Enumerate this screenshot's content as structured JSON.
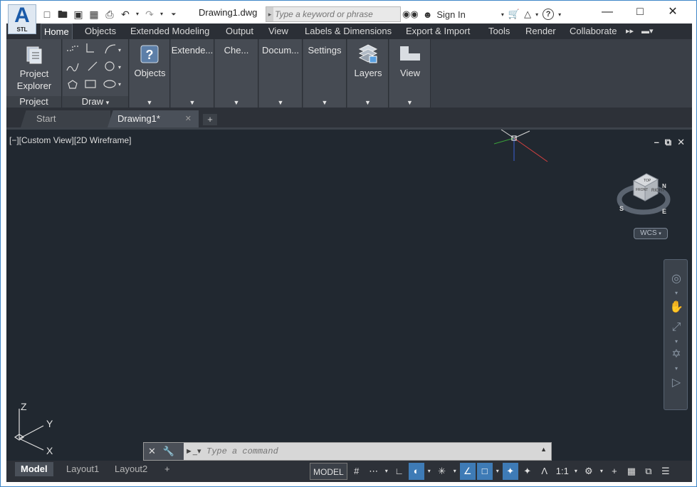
{
  "app": {
    "logo_letter": "A",
    "logo_sub": "STL",
    "document_title": "Drawing1.dwg"
  },
  "search": {
    "placeholder": "Type a keyword or phrase"
  },
  "titlebar": {
    "sign_in": "Sign In"
  },
  "ribbon_tabs": [
    "Home",
    "Objects",
    "Extended Modeling",
    "Output",
    "View",
    "Labels & Dimensions",
    "Export & Import",
    "Tools",
    "Render",
    "Collaborate"
  ],
  "ribbon_panels": {
    "project": {
      "button": "Project Explorer",
      "label": "Project"
    },
    "draw": {
      "label": "Draw"
    },
    "objects": {
      "button": "Objects"
    },
    "extended": {
      "title": "Extende..."
    },
    "check": {
      "title": "Che..."
    },
    "document": {
      "title": "Docum..."
    },
    "settings": {
      "title": "Settings"
    },
    "layers": {
      "button": "Layers"
    },
    "view": {
      "button": "View"
    }
  },
  "file_tabs": [
    "Start",
    "Drawing1*"
  ],
  "viewport": {
    "label": "[−][Custom View][2D Wireframe]",
    "wcs": "WCS",
    "ucs_labels": {
      "x": "X",
      "y": "Y",
      "z": "Z"
    },
    "viewcube": {
      "face_right": "RIGHT",
      "face_top": "TOP",
      "face_front": "FRONT",
      "south": "S",
      "east": "E",
      "north": "N"
    }
  },
  "command": {
    "placeholder": "Type a command"
  },
  "layout_tabs": [
    "Model",
    "Layout1",
    "Layout2"
  ],
  "status": {
    "model": "MODEL",
    "scale": "1:1"
  }
}
